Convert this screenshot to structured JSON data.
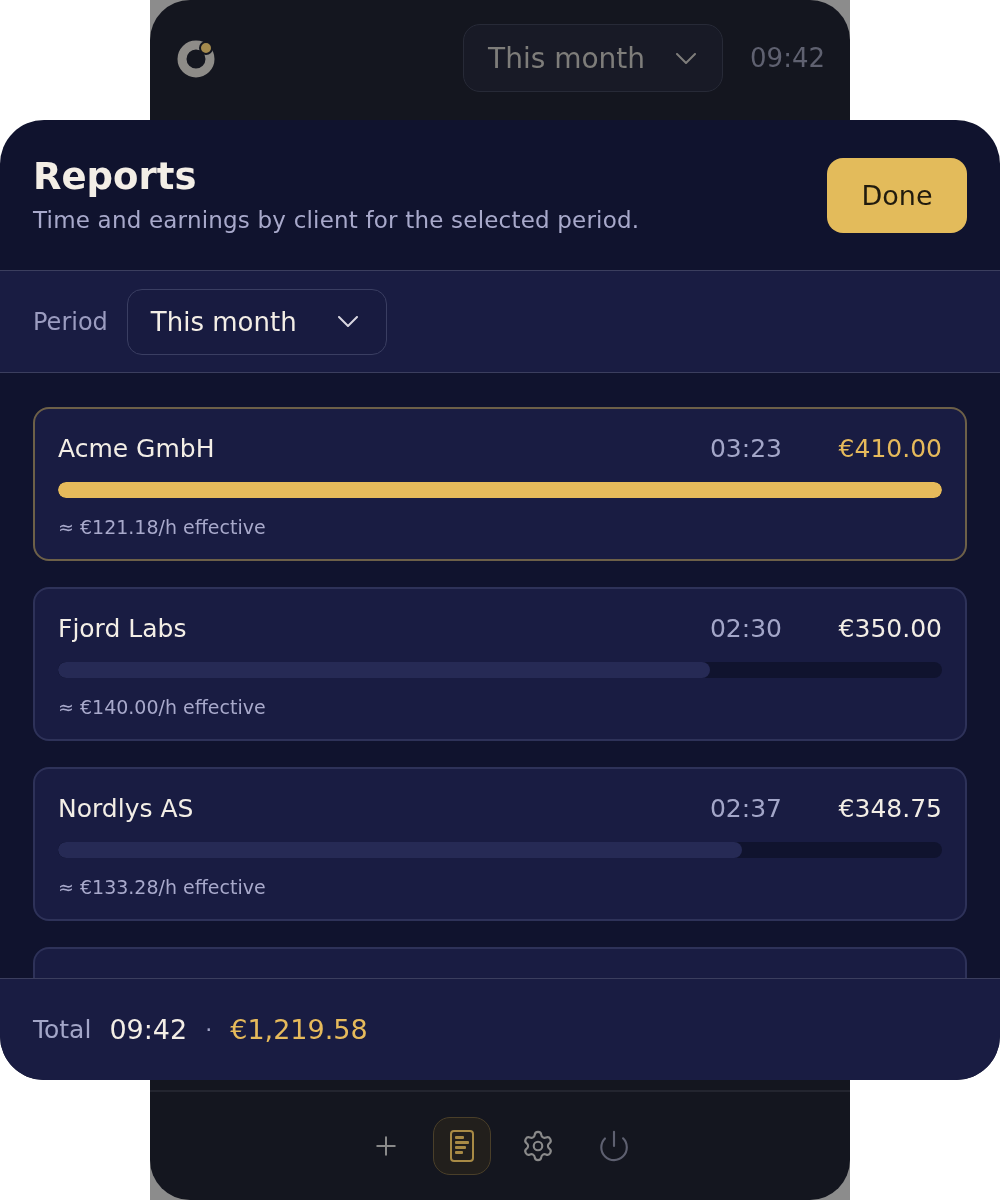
{
  "background_app": {
    "period_select": {
      "value": "This month"
    },
    "time": "09:42",
    "nav": [
      {
        "kind": "add",
        "selected": false
      },
      {
        "kind": "reports",
        "selected": true
      },
      {
        "kind": "settings",
        "selected": false
      },
      {
        "kind": "power",
        "selected": false
      }
    ]
  },
  "sheet": {
    "title": "Reports",
    "subtitle": "Time and earnings by client for the selected period.",
    "done_button": "Done",
    "period": {
      "label": "Period",
      "value": "This month"
    },
    "clients": [
      {
        "name": "Acme GmbH",
        "time": "03:23",
        "amount": "€410.00",
        "level": 1,
        "rate": "≈ €121.18/h effective",
        "highlighted": true
      },
      {
        "name": "Fjord Labs",
        "time": "02:30",
        "amount": "€350.00",
        "level": 0.738,
        "rate": "≈ €140.00/h effective",
        "highlighted": false
      },
      {
        "name": "Nordlys AS",
        "time": "02:37",
        "amount": "€348.75",
        "level": 0.774,
        "rate": "≈ €133.28/h effective",
        "highlighted": false
      }
    ],
    "more_below": true,
    "total": {
      "label": "Total",
      "time": "09:42",
      "separator": "·",
      "amount": "€1,219.58"
    }
  }
}
